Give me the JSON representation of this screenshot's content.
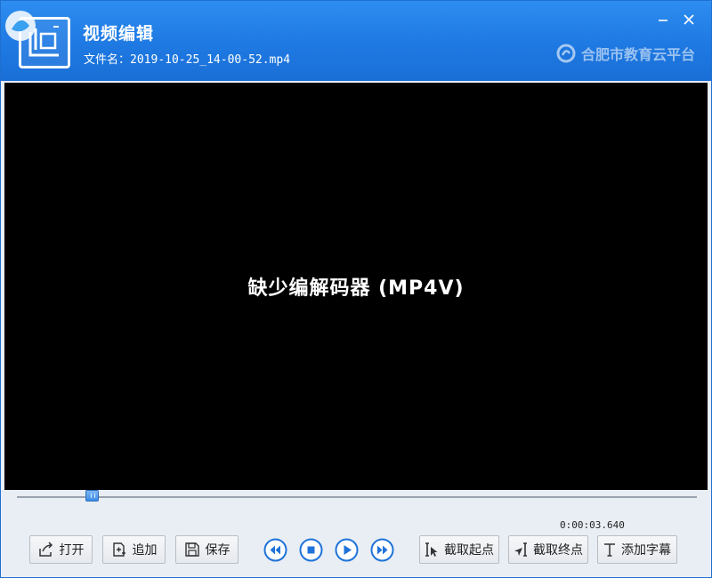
{
  "window": {
    "title": "视频编辑",
    "filename_label": "文件名：",
    "filename": "2019-10-25_14-00-52.mp4",
    "brand": "合肥市教育云平台"
  },
  "icons": {
    "minimize": "minimize-icon",
    "close": "close-icon",
    "brand_logo": "cloud-logo-icon"
  },
  "video": {
    "message": "缺少编解码器 (MP4V)"
  },
  "playback": {
    "time": "0:00:03.640",
    "progress_fraction": 0.11
  },
  "toolbar": {
    "open": "打开",
    "append": "追加",
    "save": "保存",
    "set_start": "截取起点",
    "set_end": "截取终点",
    "add_subtitle": "添加字幕"
  },
  "colors": {
    "titlebar": "#1e79e2",
    "accent": "#1f6fd0",
    "video_bg": "#000000"
  }
}
